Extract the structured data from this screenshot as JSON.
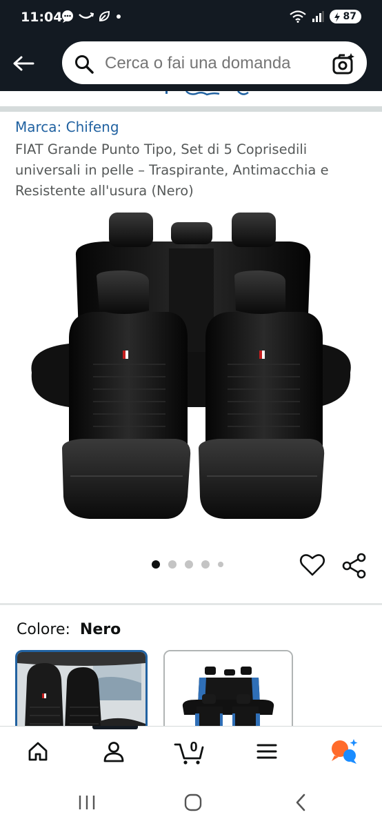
{
  "status_bar": {
    "time": "11:04",
    "battery": "87",
    "left_icons": [
      "message-icon",
      "swoosh-icon",
      "leaf-icon",
      "dot-icon"
    ],
    "right_icons": [
      "wifi-icon",
      "signal-icon",
      "battery-icon"
    ]
  },
  "header": {
    "search_placeholder": "Cerca o fai una domanda",
    "colors": {
      "background": "#131a22"
    }
  },
  "product": {
    "brand": "Marca: Chifeng",
    "title": "FIAT Grande Punto Tipo, Set di 5 Coprisedili universali in pelle – Traspirante, Antimacchia e Resistente all'usura (Nero)",
    "image_count": 5,
    "active_image": 1
  },
  "variants": {
    "label": "Colore:",
    "selected": "Nero",
    "swatches": [
      "black-interior-photo",
      "black-blue-seat-set"
    ]
  },
  "bottom_nav": {
    "items": [
      "home-icon",
      "account-icon",
      "cart-icon",
      "menu-icon",
      "rufus-icon"
    ],
    "cart_count": "0"
  },
  "colors": {
    "brand_link": "#2162a1",
    "accent_orange": "#ff6b2b",
    "accent_blue": "#1a8cff",
    "selected_border": "#2162a1"
  }
}
